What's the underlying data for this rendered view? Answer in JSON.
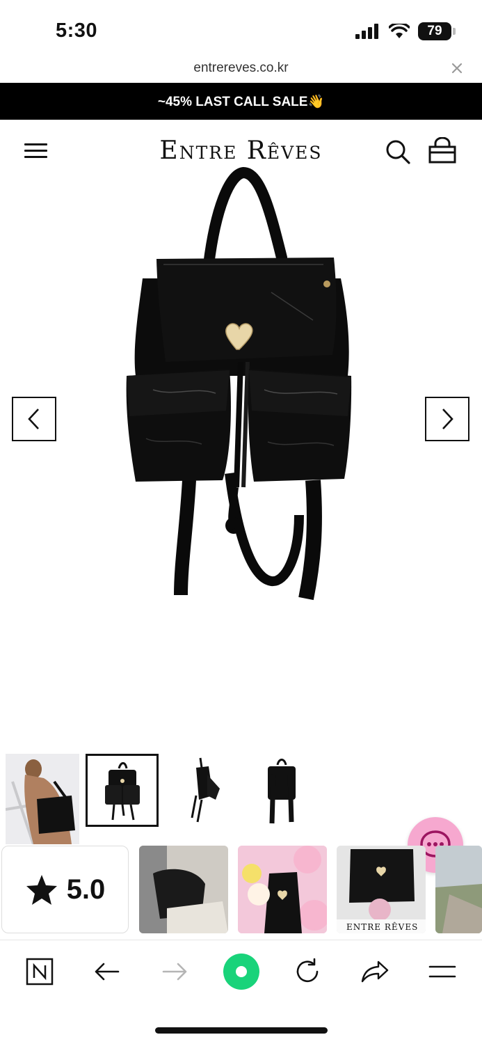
{
  "status_bar": {
    "time": "5:30",
    "battery": "79",
    "icons": [
      "signal-icon",
      "wifi-icon",
      "battery-icon"
    ]
  },
  "browser": {
    "url": "entrereves.co.kr",
    "close_icon": "close-icon"
  },
  "banner": {
    "text": "~45% LAST CALL SALE👋"
  },
  "header": {
    "logo": "Entre Rêves",
    "icons": [
      "menu-icon",
      "search-icon",
      "cart-icon"
    ]
  },
  "product": {
    "image_alt": "black patent leather backpack with heart clasp",
    "prev_icon": "chevron-left-icon",
    "next_icon": "chevron-right-icon"
  },
  "thumbnails": [
    {
      "label": "model wearing backpack"
    },
    {
      "label": "backpack front",
      "active": true
    },
    {
      "label": "backpack side"
    },
    {
      "label": "backpack back"
    }
  ],
  "reviews": {
    "rating": "5.0",
    "star_icon": "star-icon",
    "photos": [
      "review-photo-1",
      "review-photo-2",
      "review-photo-3",
      "review-photo-4"
    ],
    "photo_caption": "ENTRE RÊVES"
  },
  "chat": {
    "icon": "chat-icon"
  },
  "toolbar": {
    "items": [
      "naver-icon",
      "back-icon",
      "forward-icon",
      "home-circle-icon",
      "reload-icon",
      "share-icon",
      "menu-icon"
    ]
  },
  "colors": {
    "banner_bg": "#000000",
    "chat_bg": "#f6a8cf",
    "home_circle": "#19d37a"
  }
}
